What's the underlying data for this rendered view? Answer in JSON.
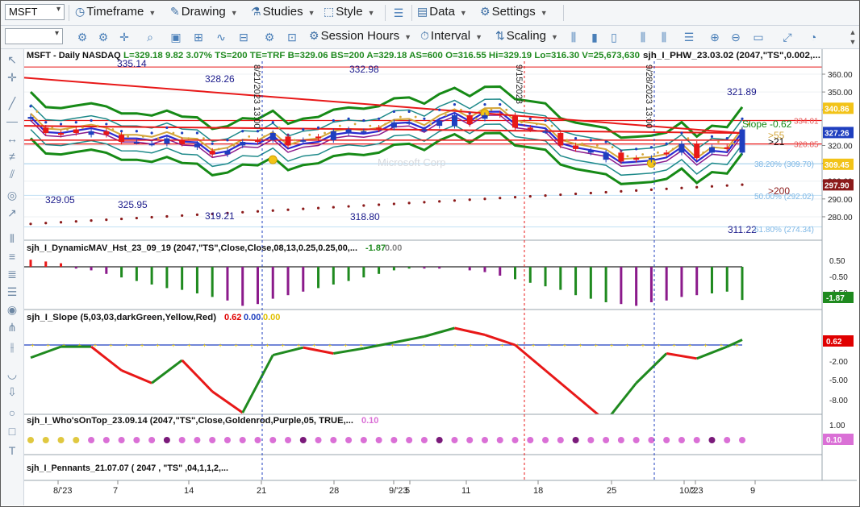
{
  "toolbar": {
    "symbol": "MSFT",
    "timeframe": "Timeframe",
    "drawing": "Drawing",
    "studies": "Studies",
    "style": "Style",
    "data": "Data",
    "settings": "Settings",
    "session_hours": "Session Hours",
    "interval": "Interval",
    "scaling": "Scaling"
  },
  "price_panel": {
    "header": "MSFT - Daily NASDAQ",
    "stats": "L=329.18  9.82  3.07%  TS=200  TE=TRF  B=329.06  BS=200  A=329.18  AS=600  O=316.55  Hi=329.19  Lo=316.30  V=25,673,630",
    "study": "sjh_I_PHW_23.03.02 (2047,\"TS\",0.002,...",
    "watermark": "Microsoft Corp",
    "annotations": [
      "335.14",
      "328.26",
      "332.98",
      "321.89",
      "329.05",
      "325.95",
      "319.21",
      "318.80",
      "311.22"
    ],
    "fib_levels": [
      "38.20% (309.70)",
      "50.00% (292.02)",
      "61.80% (274.34)"
    ],
    "markers": [
      "Slope -0.62",
      ">55",
      ">21",
      ">200"
    ],
    "vlines": [
      "8/21/2023 13:00",
      "9/15/2023",
      "9/28/2023 13:00"
    ],
    "axis_ticks": [
      "360.00",
      "350.00",
      "340.00",
      "320.00",
      "310.00",
      "300.00",
      "290.00",
      "280.00"
    ],
    "right_levels": [
      "334.01",
      "320.85"
    ],
    "price_tags": [
      {
        "label": "340.86",
        "color": "#f2c318"
      },
      {
        "label": "327.26",
        "color": "#1f3fbf"
      },
      {
        "label": "309.45",
        "color": "#f2c318"
      },
      {
        "label": "297.90",
        "color": "#8b1a1a"
      }
    ]
  },
  "panels": [
    {
      "title": "sjh_I_DynamicMAV_Hst_23_09_19 (2047,\"TS\",Close,Close,08,13,0.25,0.25,00,...",
      "v1": "-1.87",
      "v2": "0.00",
      "v1_color": "#1f8a1f",
      "v2_color": "#888888",
      "ticks": [
        "0.50",
        "-0.50",
        "-1.50"
      ],
      "tag": "-1.87",
      "tag_color": "#1f8a1f"
    },
    {
      "title": "sjh_I_Slope (5,03,03,darkGreen,Yellow,Red)",
      "v1": "0.62",
      "v2": "0.00",
      "v3": "0.00",
      "v1_color": "#e00000",
      "v2_color": "#1f3fbf",
      "v3_color": "#e0c000",
      "ticks": [
        "-2.00",
        "-5.00",
        "-8.00"
      ],
      "tag": "0.62",
      "tag_color": "#e00000"
    },
    {
      "title": "sjh_I_Who'sOnTop_23.09.14 (2047,\"TS\",Close,Goldenrod,Purple,05,  TRUE,...",
      "v1": "0.10",
      "v1_color": "#da70d6",
      "ticks": [
        "1.00",
        "-1.00"
      ],
      "tag": "0.10",
      "tag_color": "#da70d6"
    },
    {
      "title": "sjh_I_Pennants_21.07.07 (  2047 ,  \"TS\" ,04,1,1,2,..."
    }
  ],
  "x_axis": [
    "8/'23",
    "7",
    "14",
    "21",
    "28",
    "9/'23",
    "5",
    "11",
    "18",
    "25",
    "10/'23",
    "2",
    "9"
  ],
  "chart_data": [
    {
      "type": "bar",
      "title": "MSFT - Daily NASDAQ",
      "ylim": [
        270,
        365
      ],
      "categories": [
        "8/1",
        "8/2",
        "8/3",
        "8/4",
        "8/7",
        "8/8",
        "8/9",
        "8/10",
        "8/11",
        "8/14",
        "8/15",
        "8/16",
        "8/17",
        "8/18",
        "8/21",
        "8/22",
        "8/23",
        "8/24",
        "8/25",
        "8/28",
        "8/29",
        "8/30",
        "8/31",
        "9/1",
        "9/5",
        "9/6",
        "9/7",
        "9/8",
        "9/11",
        "9/12",
        "9/13",
        "9/14",
        "9/15",
        "9/18",
        "9/19",
        "9/20",
        "9/21",
        "9/22",
        "9/25",
        "9/26",
        "9/27",
        "9/28",
        "9/29",
        "10/2",
        "10/3",
        "10/4",
        "10/5",
        "10/6"
      ],
      "open": [
        335,
        330,
        327,
        329,
        326,
        328,
        326,
        322,
        321,
        321,
        323,
        319,
        317,
        315,
        320,
        323,
        323,
        325,
        323,
        325,
        323,
        327,
        328,
        330,
        330,
        333,
        329,
        331,
        331,
        337,
        335,
        338,
        337,
        330,
        328,
        327,
        320,
        316,
        312,
        316,
        313,
        312,
        316,
        316,
        321,
        316,
        319,
        316
      ],
      "close": [
        336,
        327,
        326,
        327,
        328,
        326,
        322,
        322,
        321,
        324,
        321,
        321,
        315,
        317,
        322,
        322,
        327,
        320,
        323,
        324,
        328,
        329,
        328,
        329,
        333,
        333,
        329,
        334,
        337,
        332,
        337,
        337,
        330,
        329,
        328,
        320,
        318,
        317,
        316,
        311,
        312,
        313,
        315,
        321,
        313,
        319,
        318,
        329
      ]
    },
    {
      "type": "bar",
      "title": "sjh_I_DynamicMAV_Hst_23_09_19",
      "categories": [
        "8/1",
        "8/2",
        "8/3",
        "8/4",
        "8/7",
        "8/8",
        "8/9",
        "8/10",
        "8/11",
        "8/14",
        "8/15",
        "8/16",
        "8/17",
        "8/18",
        "8/21",
        "8/22",
        "8/23",
        "8/24",
        "8/25",
        "8/28",
        "8/29",
        "8/30",
        "8/31",
        "9/1",
        "9/5",
        "9/6",
        "9/7",
        "9/8",
        "9/11",
        "9/12",
        "9/13",
        "9/14",
        "9/15",
        "9/18",
        "9/19",
        "9/20",
        "9/21",
        "9/22",
        "9/25",
        "9/26",
        "9/27",
        "9/28",
        "9/29",
        "10/2",
        "10/3",
        "10/4",
        "10/5",
        "10/6"
      ],
      "values": [
        0.4,
        0.3,
        0.2,
        -0.1,
        -0.2,
        -0.4,
        -0.6,
        -0.8,
        -1.0,
        -1.2,
        -1.3,
        -1.5,
        -1.7,
        -1.9,
        -2.2,
        -2.1,
        -1.8,
        -1.6,
        -1.4,
        -1.2,
        -1.0,
        -0.8,
        -0.6,
        -0.4,
        -0.2,
        -0.1,
        -0.1,
        -0.1,
        0.0,
        -0.2,
        -0.3,
        -0.5,
        -0.7,
        -0.9,
        -1.1,
        -1.3,
        -1.6,
        -1.8,
        -2.0,
        -2.1,
        -2.2,
        -2.0,
        -1.9,
        -1.7,
        -1.6,
        -1.5,
        -1.4,
        -1.87
      ]
    },
    {
      "type": "line",
      "title": "sjh_I_Slope (5,03,03,darkGreen,Yellow,Red)",
      "ylim": [
        -9,
        2
      ],
      "x": [
        "8/1",
        "8/3",
        "8/7",
        "8/9",
        "8/11",
        "8/15",
        "8/17",
        "8/21",
        "8/23",
        "8/25",
        "8/29",
        "8/31",
        "9/5",
        "9/7",
        "9/11",
        "9/13",
        "9/15",
        "9/19",
        "9/21",
        "9/25",
        "9/27",
        "9/29",
        "10/3",
        "10/5",
        "10/6"
      ],
      "values": [
        -1.5,
        -0.2,
        -0.2,
        -3.0,
        -4.5,
        -1.8,
        -5.5,
        -8.0,
        -1.2,
        -0.3,
        -1.0,
        -0.4,
        0.3,
        1.0,
        2.0,
        1.2,
        0.0,
        -3.0,
        -6.0,
        -9.0,
        -4.5,
        -1.0,
        -1.6,
        -0.2,
        0.62
      ]
    }
  ]
}
